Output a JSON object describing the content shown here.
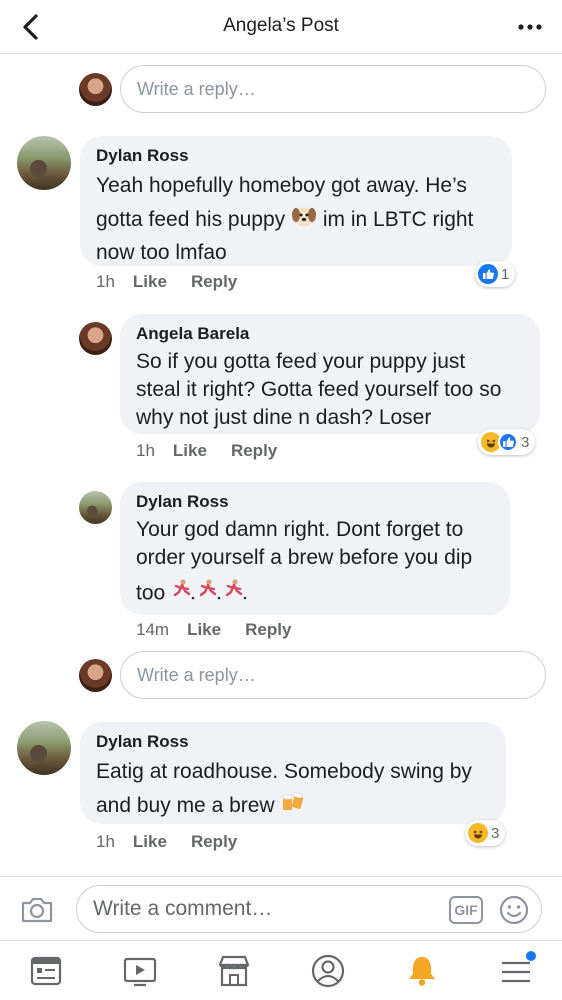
{
  "header": {
    "title": "Angela’s Post"
  },
  "reply_placeholder": "Write a reply…",
  "comments": [
    {
      "name": "Dylan Ross",
      "lines": [
        "Yeah hopefully homeboy got away. He’s",
        "gotta feed his puppy",
        "im in LBTC right",
        "now too lmfao"
      ],
      "time": "1h",
      "like": "Like",
      "reply": "Reply",
      "reaction_count": "1"
    },
    {
      "name": "Angela Barela",
      "lines": [
        "So if you gotta feed your puppy just",
        "steal it right? Gotta feed yourself too so",
        "why not just dine n dash? Loser"
      ],
      "time": "1h",
      "like": "Like",
      "reply": "Reply",
      "reaction_count": "3"
    },
    {
      "name": "Dylan Ross",
      "lines": [
        "Your god damn right. Dont forget to",
        "order yourself a brew before you dip",
        "too"
      ],
      "time": "14m",
      "like": "Like",
      "reply": "Reply"
    },
    {
      "name": "Dylan Ross",
      "lines": [
        "Eatig at roadhouse. Somebody swing by",
        "and buy me a brew"
      ],
      "time": "1h",
      "like": "Like",
      "reply": "Reply",
      "reaction_count": "3"
    }
  ],
  "composer": {
    "placeholder": "Write a comment…",
    "gif_label": "GIF"
  },
  "colors": {
    "accent": "#1877f2",
    "bubble": "#f0f2f5",
    "meta": "#65676b"
  }
}
